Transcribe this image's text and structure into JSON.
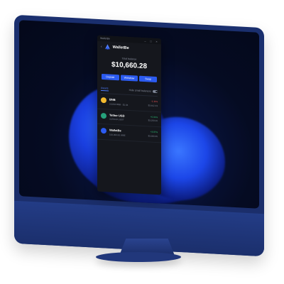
{
  "window": {
    "title": "WalletBe",
    "minimize": "–",
    "maximize": "□",
    "close": "×"
  },
  "header": {
    "app_name": "WalletBe",
    "back": "‹"
  },
  "balance": {
    "label": "Total balance",
    "value": "$10,660.28"
  },
  "actions": [
    {
      "label": "Deposit"
    },
    {
      "label": "Withdraw"
    },
    {
      "label": "Swap"
    }
  ],
  "tabs": {
    "assets": "Assets",
    "hide_small": "Hide small balances"
  },
  "assets": [
    {
      "name": "BNB",
      "sub": "0.0054 BNB · $1.84",
      "change": "-1.11%",
      "value": "$3,402.43",
      "trend": "neg"
    },
    {
      "name": "Tether USD",
      "sub": "3,258.00 USDT",
      "change": "+0.01%",
      "value": "$3,258.00",
      "trend": "pos"
    },
    {
      "name": "WalletBe",
      "sub": "100,000.00 WBE",
      "change": "+3.87%",
      "value": "$3,999.85",
      "trend": "pos"
    }
  ],
  "colors": {
    "accent": "#2c5bf0",
    "monitor": "#1b2e6a",
    "app_bg": "#15171d"
  }
}
